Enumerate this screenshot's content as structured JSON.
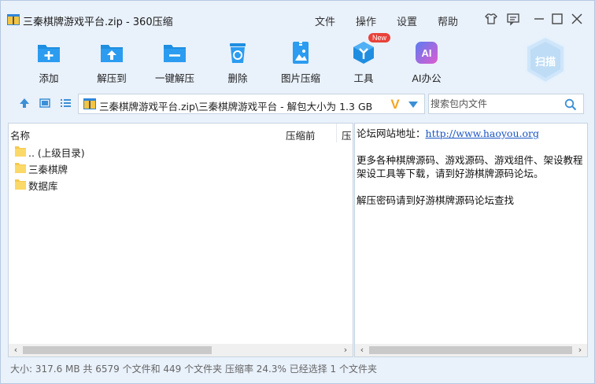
{
  "window": {
    "title": "三秦棋牌游戏平台.zip - 360压缩"
  },
  "menu": {
    "file": "文件",
    "operate": "操作",
    "settings": "设置",
    "help": "帮助"
  },
  "toolbar": {
    "add": "添加",
    "extract_to": "解压到",
    "one_click_extract": "一键解压",
    "delete": "删除",
    "image_compress": "图片压缩",
    "tools": "工具",
    "tools_badge": "New",
    "ai_office": "AI办公",
    "ai_icon_text": "AI",
    "scan": "扫描"
  },
  "address": {
    "path": "三秦棋牌游戏平台.zip\\三秦棋牌游戏平台 - 解包大小为 1.3 GB",
    "v_logo": "V"
  },
  "search": {
    "placeholder": "搜索包内文件"
  },
  "file_list": {
    "columns": {
      "name": "名称",
      "before": "压缩前",
      "after": "压"
    },
    "items": [
      {
        "name": ".. (上级目录)",
        "icon": "folder-icon"
      },
      {
        "name": "三秦棋牌",
        "icon": "folder-icon"
      },
      {
        "name": "数据库",
        "icon": "folder-icon"
      }
    ]
  },
  "preview": {
    "line1_prefix": "论坛网站地址：",
    "line1_link": "http://www.haoyou.org",
    "line2": "更多各种棋牌源码、游戏源码、游戏组件、架设教程",
    "line3": "架设工具等下载，请到好游棋牌源码论坛。",
    "line4": "解压密码请到好游棋牌源码论坛查找"
  },
  "status": {
    "text": "大小: 317.6 MB 共 6579 个文件和 449 个文件夹 压缩率 24.3% 已经选择 1 个文件夹"
  },
  "colors": {
    "accent": "#1f8ee0",
    "window_bg": "#e9f1fb",
    "badge": "#e8423a",
    "ai_gradient_start": "#5a7cf0",
    "ai_gradient_end": "#e05bd0"
  }
}
